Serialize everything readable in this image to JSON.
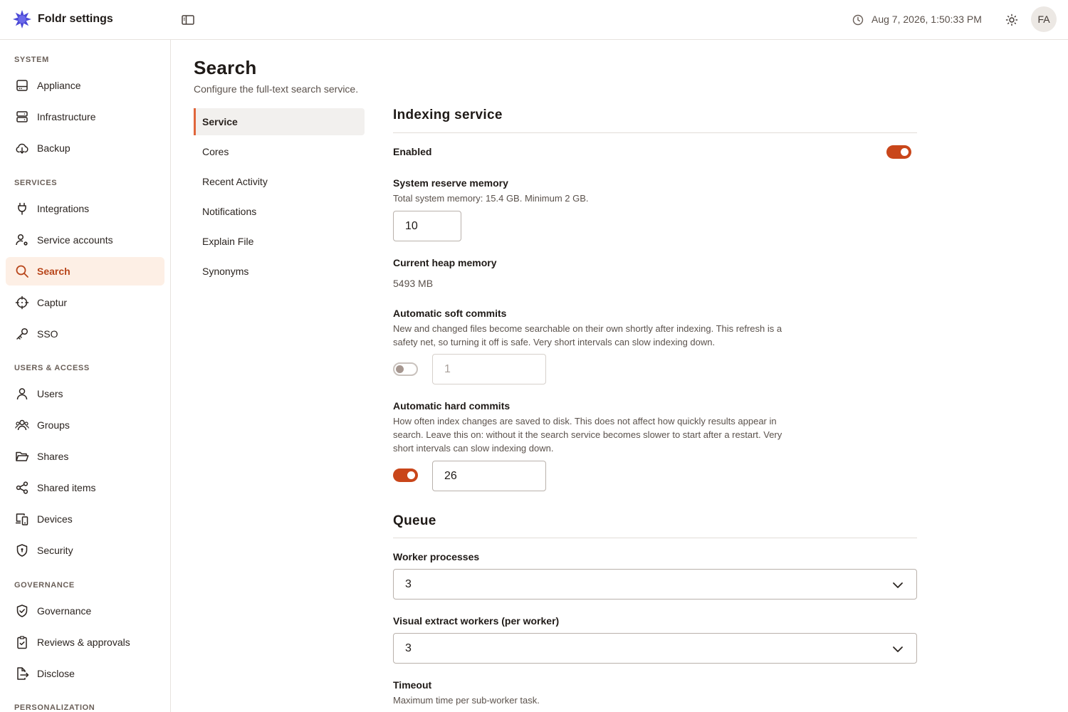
{
  "header": {
    "app_title": "Foldr settings",
    "datetime": "Aug 7, 2026, 1:50:33 PM",
    "avatar_initials": "FA"
  },
  "sidebar": {
    "sections": [
      {
        "label": "SYSTEM",
        "items": [
          {
            "label": "Appliance",
            "icon": "appliance-icon"
          },
          {
            "label": "Infrastructure",
            "icon": "server-icon"
          },
          {
            "label": "Backup",
            "icon": "cloud-download-icon"
          }
        ]
      },
      {
        "label": "SERVICES",
        "items": [
          {
            "label": "Integrations",
            "icon": "plug-icon"
          },
          {
            "label": "Service accounts",
            "icon": "user-cog-icon"
          },
          {
            "label": "Search",
            "icon": "search-icon",
            "active": true
          },
          {
            "label": "Captur",
            "icon": "crosshair-icon"
          },
          {
            "label": "SSO",
            "icon": "key-icon"
          }
        ]
      },
      {
        "label": "USERS & ACCESS",
        "items": [
          {
            "label": "Users",
            "icon": "user-icon"
          },
          {
            "label": "Groups",
            "icon": "users-icon"
          },
          {
            "label": "Shares",
            "icon": "folder-open-icon"
          },
          {
            "label": "Shared items",
            "icon": "share-icon"
          },
          {
            "label": "Devices",
            "icon": "devices-icon"
          },
          {
            "label": "Security",
            "icon": "shield-icon"
          }
        ]
      },
      {
        "label": "GOVERNANCE",
        "items": [
          {
            "label": "Governance",
            "icon": "shield-check-icon"
          },
          {
            "label": "Reviews & approvals",
            "icon": "clipboard-check-icon"
          },
          {
            "label": "Disclose",
            "icon": "file-export-icon"
          }
        ]
      },
      {
        "label": "PERSONALIZATION",
        "items": []
      }
    ]
  },
  "page": {
    "title": "Search",
    "subtitle": "Configure the full-text search service."
  },
  "subnav": {
    "items": [
      {
        "label": "Service",
        "active": true
      },
      {
        "label": "Cores"
      },
      {
        "label": "Recent Activity"
      },
      {
        "label": "Notifications"
      },
      {
        "label": "Explain File"
      },
      {
        "label": "Synonyms"
      }
    ]
  },
  "indexing": {
    "heading": "Indexing service",
    "enabled_label": "Enabled",
    "enabled": true,
    "reserve_label": "System reserve memory",
    "reserve_help": "Total system memory: 15.4 GB. Minimum 2 GB.",
    "reserve_value": "10",
    "heap_label": "Current heap memory",
    "heap_value": "5493 MB",
    "soft_label": "Automatic soft commits",
    "soft_help": "New and changed files become searchable on their own shortly after indexing. This refresh is a safety net, so turning it off is safe. Very short intervals can slow indexing down.",
    "soft_enabled": false,
    "soft_value": "1",
    "hard_label": "Automatic hard commits",
    "hard_help": "How often index changes are saved to disk. This does not affect how quickly results appear in search. Leave this on: without it the search service becomes slower to start after a restart. Very short intervals can slow indexing down.",
    "hard_enabled": true,
    "hard_value": "26"
  },
  "queue": {
    "heading": "Queue",
    "workers_label": "Worker processes",
    "workers_value": "3",
    "visual_label": "Visual extract workers (per worker)",
    "visual_value": "3",
    "timeout_label": "Timeout",
    "timeout_help": "Maximum time per sub-worker task."
  },
  "colors": {
    "accent": "#c9461a",
    "active_bg": "#fdefe5",
    "active_text": "#b8461b",
    "logo": "#4b49d6"
  }
}
